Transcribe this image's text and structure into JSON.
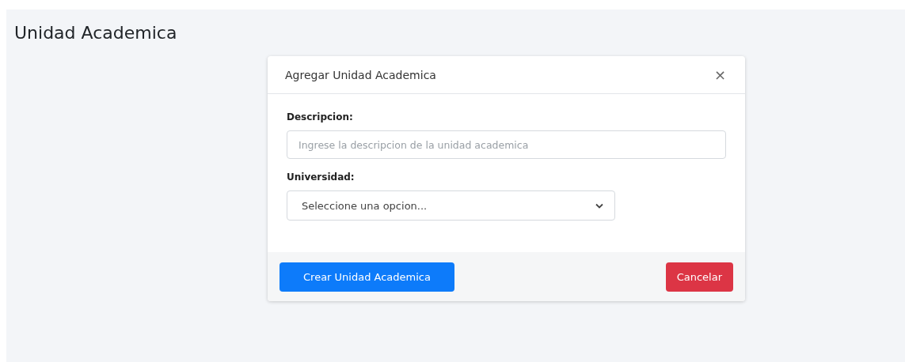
{
  "page": {
    "title": "Unidad Academica"
  },
  "modal": {
    "title": "Agregar Unidad Academica",
    "close": "×",
    "fields": [
      {
        "kind": "text",
        "label": "Descripcion:",
        "placeholder": "Ingrese la descripcion de la unidad academica"
      },
      {
        "kind": "select",
        "label": "Universidad:",
        "value": "Seleccione una opcion..."
      }
    ],
    "buttons": [
      {
        "kind": "primary",
        "label": "Crear Unidad Academica"
      },
      {
        "kind": "danger",
        "label": "Cancelar"
      }
    ]
  }
}
